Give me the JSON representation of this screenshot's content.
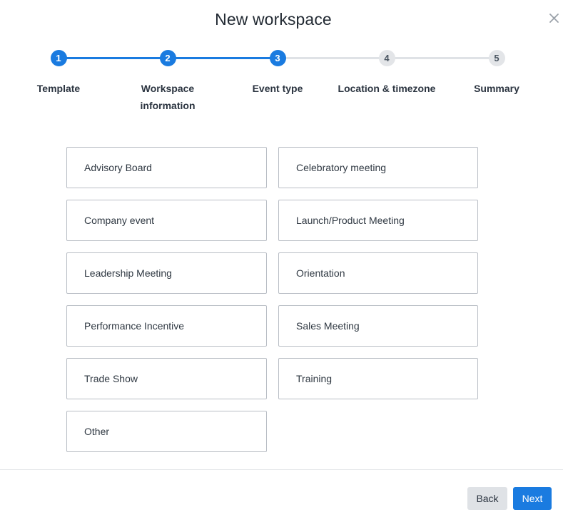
{
  "dialog": {
    "title": "New workspace"
  },
  "stepper": {
    "steps": [
      {
        "number": "1",
        "label": "Template",
        "status": "complete"
      },
      {
        "number": "2",
        "label": "Workspace information",
        "status": "complete"
      },
      {
        "number": "3",
        "label": "Event type",
        "status": "current"
      },
      {
        "number": "4",
        "label": "Location & timezone",
        "status": "pending"
      },
      {
        "number": "5",
        "label": "Summary",
        "status": "pending"
      }
    ],
    "step2_label_line1": "Workspace",
    "step2_label_line2": "information"
  },
  "event_types": [
    "Advisory Board",
    "Celebratory meeting",
    "Company event",
    "Launch/Product Meeting",
    "Leadership Meeting",
    "Orientation",
    "Performance Incentive",
    "Sales Meeting",
    "Trade Show",
    "Training",
    "Other"
  ],
  "footer": {
    "back_label": "Back",
    "next_label": "Next"
  },
  "colors": {
    "accent": "#1a7be0",
    "pending_step": "#e3e5e8",
    "option_border": "#b9bec5"
  },
  "icons": {
    "close": "close-icon"
  }
}
